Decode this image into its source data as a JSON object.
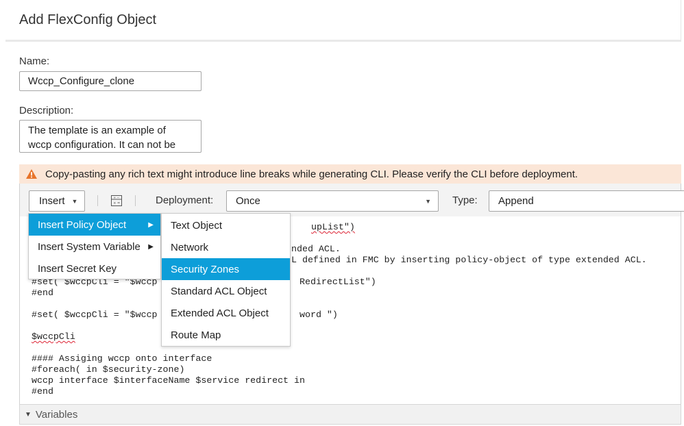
{
  "dialog": {
    "title": "Add FlexConfig Object"
  },
  "name": {
    "label": "Name:",
    "value": "Wccp_Configure_clone"
  },
  "description": {
    "label": "Description:",
    "lines": [
      "The template is an example of",
      "wccp configuration. It can not be"
    ]
  },
  "warning": {
    "text": "Copy-pasting any rich text might introduce line breaks while generating CLI. Please verify the CLI before deployment.",
    "color": "#e8742a"
  },
  "toolbar": {
    "insert_label": "Insert",
    "deployment_label": "Deployment:",
    "deployment_value": "Once",
    "type_label": "Type:",
    "type_value": "Append"
  },
  "insert_menu": {
    "items": [
      {
        "label": "Insert Policy Object",
        "submenu": true,
        "active": true
      },
      {
        "label": "Insert System Variable",
        "submenu": true,
        "active": false
      },
      {
        "label": "Insert Secret Key",
        "submenu": false,
        "active": false
      }
    ]
  },
  "policy_object_menu": {
    "items": [
      {
        "label": "Text Object",
        "active": false
      },
      {
        "label": "Network",
        "active": false
      },
      {
        "label": "Security Zones",
        "active": true
      },
      {
        "label": "Standard ACL Object",
        "active": false
      },
      {
        "label": "Extended ACL Object",
        "active": false
      },
      {
        "label": "Route Map",
        "active": false
      }
    ]
  },
  "code": {
    "l1_tail": "upList\")",
    "l2_tail": "nded ACL.",
    "l3_tail": "L defined in FMC by inserting policy-object of type extended ACL.",
    "l4_a": "#set( $wccpCli = \"$wccp",
    "l4_tail": "RedirectList\")",
    "l5": "#end",
    "l6_a": "#set( $wccpCli = \"$wccp",
    "l6_tail": "word \")",
    "l7": "$wccpCli",
    "l8": "#### Assiging wccp onto interface",
    "l9": "#foreach( in $security-zone)",
    "l10": "wccp interface $interfaceName $service redirect in",
    "l11": "#end"
  },
  "variables": {
    "label": "Variables"
  },
  "colors": {
    "accent": "#0d9ed9",
    "warning_bg": "#fbe6d7"
  }
}
